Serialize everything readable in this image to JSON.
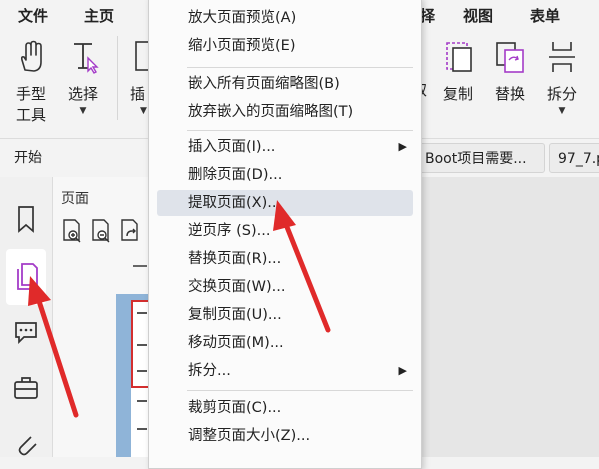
{
  "menubar": {
    "file": "文件",
    "home": "主页",
    "select_partial": "择",
    "view": "视图",
    "form": "表单"
  },
  "ribbon": {
    "hand_tool": "手型工具",
    "hand_tool_line1": "手型",
    "hand_tool_line2": "工具",
    "select": "选择",
    "insert_partial": "插",
    "partial_right": "取",
    "copy": "复制",
    "replace": "替换",
    "split": "拆分"
  },
  "tabs": {
    "start": "开始",
    "doc1": "Boot项目需要...",
    "doc2": "97_7.p"
  },
  "panel": {
    "title": "页面"
  },
  "context_menu": {
    "items": [
      {
        "label": "放大页面预览(A)"
      },
      {
        "label": "缩小页面预览(E)"
      },
      {
        "label": "嵌入所有页面缩略图(B)"
      },
      {
        "label": "放弃嵌入的页面缩略图(T)"
      },
      {
        "label": "插入页面(I)...",
        "submenu": "▶"
      },
      {
        "label": "删除页面(D)..."
      },
      {
        "label": "提取页面(X)..."
      },
      {
        "label": "逆页序 (S)..."
      },
      {
        "label": "替换页面(R)..."
      },
      {
        "label": "交换页面(W)..."
      },
      {
        "label": "复制页面(U)..."
      },
      {
        "label": "移动页面(M)..."
      },
      {
        "label": "拆分...",
        "submenu": "▶"
      },
      {
        "label": "裁剪页面(C)..."
      },
      {
        "label": "调整页面大小(Z)..."
      }
    ]
  },
  "colors": {
    "accent_purple": "#a43cc8",
    "annotation_red": "#e02a2a",
    "highlight": "#dfe3ea"
  }
}
